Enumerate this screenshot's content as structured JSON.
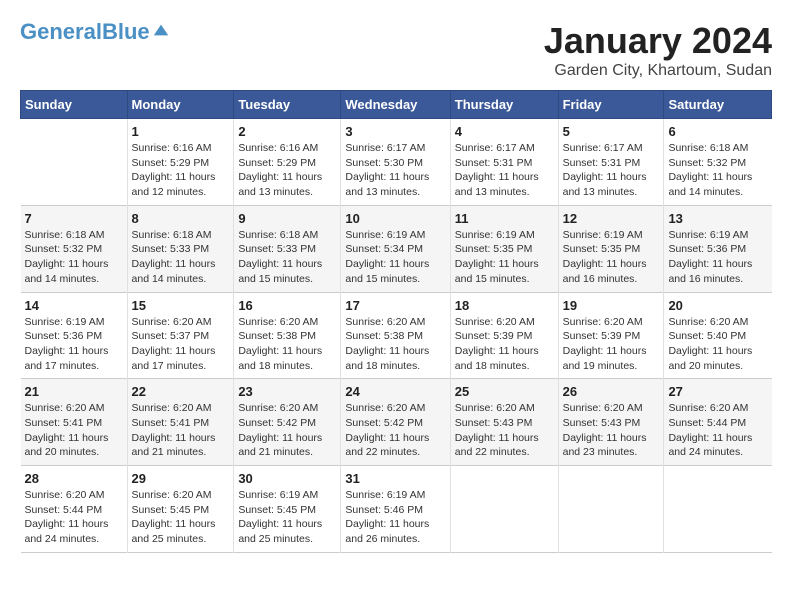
{
  "logo": {
    "line1": "General",
    "line2": "Blue"
  },
  "title": "January 2024",
  "subtitle": "Garden City, Khartoum, Sudan",
  "headers": [
    "Sunday",
    "Monday",
    "Tuesday",
    "Wednesday",
    "Thursday",
    "Friday",
    "Saturday"
  ],
  "weeks": [
    [
      {
        "day": "",
        "text": ""
      },
      {
        "day": "1",
        "text": "Sunrise: 6:16 AM\nSunset: 5:29 PM\nDaylight: 11 hours and 12 minutes."
      },
      {
        "day": "2",
        "text": "Sunrise: 6:16 AM\nSunset: 5:29 PM\nDaylight: 11 hours and 13 minutes."
      },
      {
        "day": "3",
        "text": "Sunrise: 6:17 AM\nSunset: 5:30 PM\nDaylight: 11 hours and 13 minutes."
      },
      {
        "day": "4",
        "text": "Sunrise: 6:17 AM\nSunset: 5:31 PM\nDaylight: 11 hours and 13 minutes."
      },
      {
        "day": "5",
        "text": "Sunrise: 6:17 AM\nSunset: 5:31 PM\nDaylight: 11 hours and 13 minutes."
      },
      {
        "day": "6",
        "text": "Sunrise: 6:18 AM\nSunset: 5:32 PM\nDaylight: 11 hours and 14 minutes."
      }
    ],
    [
      {
        "day": "7",
        "text": "Sunrise: 6:18 AM\nSunset: 5:32 PM\nDaylight: 11 hours and 14 minutes."
      },
      {
        "day": "8",
        "text": "Sunrise: 6:18 AM\nSunset: 5:33 PM\nDaylight: 11 hours and 14 minutes."
      },
      {
        "day": "9",
        "text": "Sunrise: 6:18 AM\nSunset: 5:33 PM\nDaylight: 11 hours and 15 minutes."
      },
      {
        "day": "10",
        "text": "Sunrise: 6:19 AM\nSunset: 5:34 PM\nDaylight: 11 hours and 15 minutes."
      },
      {
        "day": "11",
        "text": "Sunrise: 6:19 AM\nSunset: 5:35 PM\nDaylight: 11 hours and 15 minutes."
      },
      {
        "day": "12",
        "text": "Sunrise: 6:19 AM\nSunset: 5:35 PM\nDaylight: 11 hours and 16 minutes."
      },
      {
        "day": "13",
        "text": "Sunrise: 6:19 AM\nSunset: 5:36 PM\nDaylight: 11 hours and 16 minutes."
      }
    ],
    [
      {
        "day": "14",
        "text": "Sunrise: 6:19 AM\nSunset: 5:36 PM\nDaylight: 11 hours and 17 minutes."
      },
      {
        "day": "15",
        "text": "Sunrise: 6:20 AM\nSunset: 5:37 PM\nDaylight: 11 hours and 17 minutes."
      },
      {
        "day": "16",
        "text": "Sunrise: 6:20 AM\nSunset: 5:38 PM\nDaylight: 11 hours and 18 minutes."
      },
      {
        "day": "17",
        "text": "Sunrise: 6:20 AM\nSunset: 5:38 PM\nDaylight: 11 hours and 18 minutes."
      },
      {
        "day": "18",
        "text": "Sunrise: 6:20 AM\nSunset: 5:39 PM\nDaylight: 11 hours and 18 minutes."
      },
      {
        "day": "19",
        "text": "Sunrise: 6:20 AM\nSunset: 5:39 PM\nDaylight: 11 hours and 19 minutes."
      },
      {
        "day": "20",
        "text": "Sunrise: 6:20 AM\nSunset: 5:40 PM\nDaylight: 11 hours and 20 minutes."
      }
    ],
    [
      {
        "day": "21",
        "text": "Sunrise: 6:20 AM\nSunset: 5:41 PM\nDaylight: 11 hours and 20 minutes."
      },
      {
        "day": "22",
        "text": "Sunrise: 6:20 AM\nSunset: 5:41 PM\nDaylight: 11 hours and 21 minutes."
      },
      {
        "day": "23",
        "text": "Sunrise: 6:20 AM\nSunset: 5:42 PM\nDaylight: 11 hours and 21 minutes."
      },
      {
        "day": "24",
        "text": "Sunrise: 6:20 AM\nSunset: 5:42 PM\nDaylight: 11 hours and 22 minutes."
      },
      {
        "day": "25",
        "text": "Sunrise: 6:20 AM\nSunset: 5:43 PM\nDaylight: 11 hours and 22 minutes."
      },
      {
        "day": "26",
        "text": "Sunrise: 6:20 AM\nSunset: 5:43 PM\nDaylight: 11 hours and 23 minutes."
      },
      {
        "day": "27",
        "text": "Sunrise: 6:20 AM\nSunset: 5:44 PM\nDaylight: 11 hours and 24 minutes."
      }
    ],
    [
      {
        "day": "28",
        "text": "Sunrise: 6:20 AM\nSunset: 5:44 PM\nDaylight: 11 hours and 24 minutes."
      },
      {
        "day": "29",
        "text": "Sunrise: 6:20 AM\nSunset: 5:45 PM\nDaylight: 11 hours and 25 minutes."
      },
      {
        "day": "30",
        "text": "Sunrise: 6:19 AM\nSunset: 5:45 PM\nDaylight: 11 hours and 25 minutes."
      },
      {
        "day": "31",
        "text": "Sunrise: 6:19 AM\nSunset: 5:46 PM\nDaylight: 11 hours and 26 minutes."
      },
      {
        "day": "",
        "text": ""
      },
      {
        "day": "",
        "text": ""
      },
      {
        "day": "",
        "text": ""
      }
    ]
  ]
}
